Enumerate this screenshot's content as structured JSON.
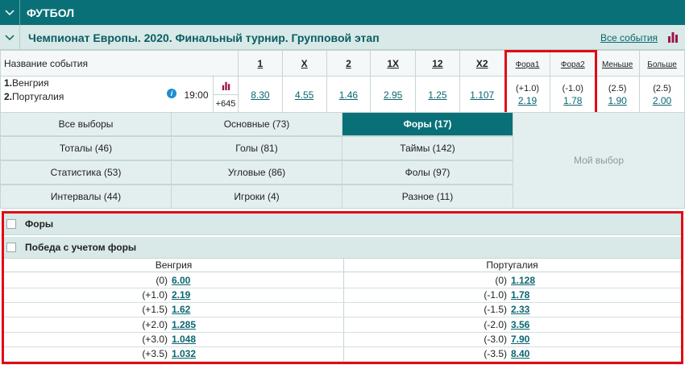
{
  "sport": {
    "title": "ФУТБОЛ"
  },
  "tournament": {
    "title": "Чемпионат Европы. 2020. Финальный турнир. Групповой этап",
    "all_events": "Все события"
  },
  "table": {
    "headers": {
      "event": "Название события",
      "c1": "1",
      "cx": "X",
      "c2": "2",
      "c1x": "1X",
      "c12": "12",
      "cx2": "X2",
      "fora1": "Фора1",
      "fora2": "Фора2",
      "less": "Меньше",
      "more": "Больше"
    },
    "event": {
      "team1_num": "1.",
      "team1": "Венгрия",
      "team2_num": "2.",
      "team2": "Португалия",
      "time": "19:00",
      "more_count": "+645",
      "odds": {
        "o1": "8.30",
        "ox": "4.55",
        "o2": "1.46",
        "o1x": "2.95",
        "o12": "1.25",
        "ox2": "1.107"
      },
      "fora1_h": "(+1.0)",
      "fora1_v": "2.19",
      "fora2_h": "(-1.0)",
      "fora2_v": "1.78",
      "less_h": "(2.5)",
      "less_v": "1.90",
      "more_h": "(2.5)",
      "more_v": "2.00"
    }
  },
  "filters": {
    "all": "Все выборы",
    "main": "Основные (73)",
    "foras": "Форы (17)",
    "totals": "Тоталы (46)",
    "goals": "Голы (81)",
    "halves": "Таймы (142)",
    "stats": "Статистика (53)",
    "corners": "Угловые (86)",
    "fouls": "Фолы (97)",
    "intervals": "Интервалы (44)",
    "players": "Игроки (4)",
    "misc": "Разное (11)",
    "my_choice": "Мой выбор"
  },
  "markets": {
    "section_title": "Форы",
    "market_title": "Победа с учетом форы",
    "col1": "Венгрия",
    "col2": "Португалия",
    "rows": [
      {
        "h1": "(0)",
        "v1": "6.00",
        "h2": "(0)",
        "v2": "1.128"
      },
      {
        "h1": "(+1.0)",
        "v1": "2.19",
        "h2": "(-1.0)",
        "v2": "1.78"
      },
      {
        "h1": "(+1.5)",
        "v1": "1.62",
        "h2": "(-1.5)",
        "v2": "2.33"
      },
      {
        "h1": "(+2.0)",
        "v1": "1.285",
        "h2": "(-2.0)",
        "v2": "3.56"
      },
      {
        "h1": "(+3.0)",
        "v1": "1.048",
        "h2": "(-3.0)",
        "v2": "7.90"
      },
      {
        "h1": "(+3.5)",
        "v1": "1.032",
        "h2": "(-3.5)",
        "v2": "8.40"
      }
    ]
  },
  "colors": {
    "header_teal": "#0a7078",
    "light_teal": "#d8e9e7",
    "link": "#0b6670",
    "highlight_red": "#e00b14",
    "chart_icon": "#a0144b"
  }
}
